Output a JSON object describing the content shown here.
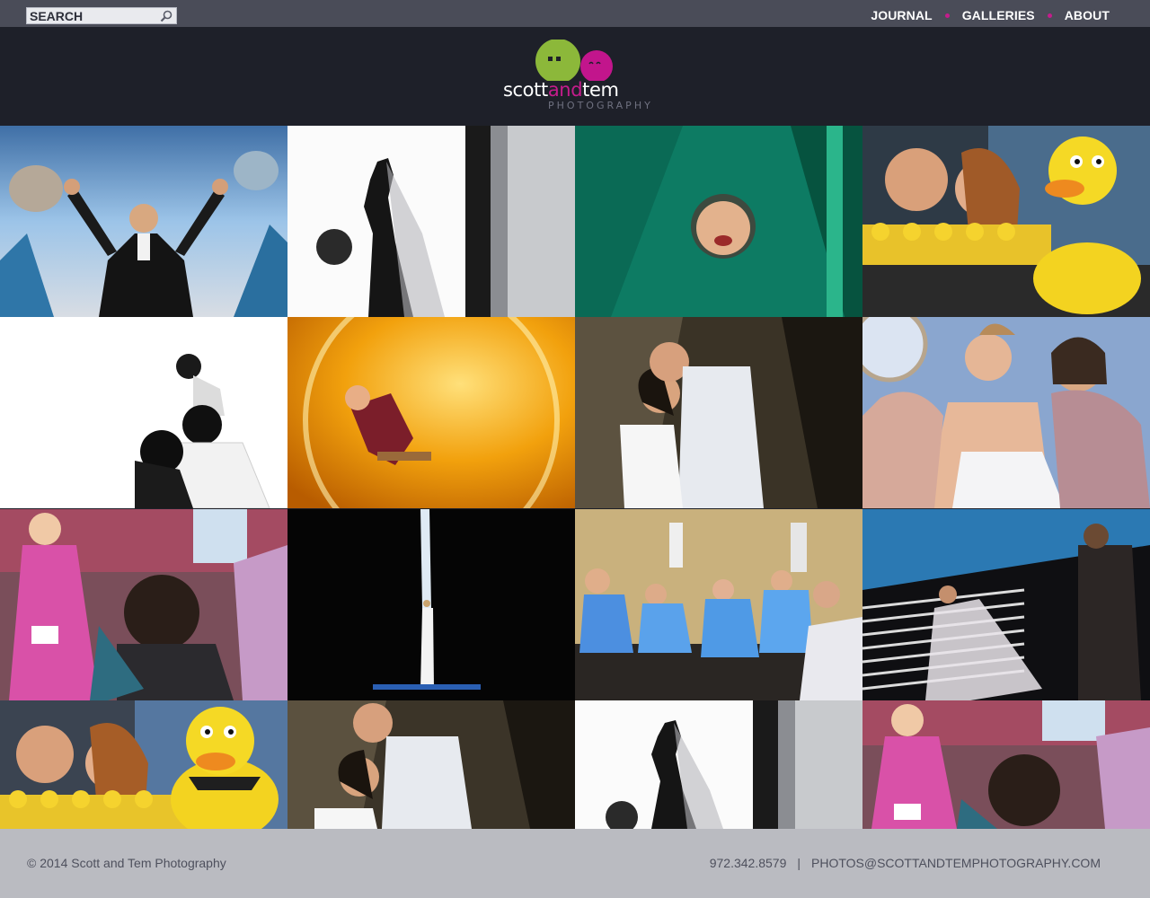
{
  "search": {
    "placeholder": "SEARCH"
  },
  "nav": {
    "items": [
      {
        "label": "JOURNAL"
      },
      {
        "label": "GALLERIES"
      },
      {
        "label": "ABOUT"
      }
    ]
  },
  "brand": {
    "logo_prefix": "scott",
    "logo_and": "and",
    "logo_suffix": "tem",
    "logo_sub": "PHOTOGRAPHY"
  },
  "colors": {
    "accent": "#c51c8c",
    "logo_green": "#8cb83a",
    "logo_magenta": "#c2158c",
    "topbar": "#4a4c58",
    "header": "#1e2029",
    "footer": "#babbc1"
  },
  "footer": {
    "copyright": "© 2014 Scott and Tem Photography",
    "phone": "972.342.8579",
    "divider": "|",
    "email": "PHOTOS@SCOTTANDTEMPHOTOGRAPHY.COM"
  }
}
